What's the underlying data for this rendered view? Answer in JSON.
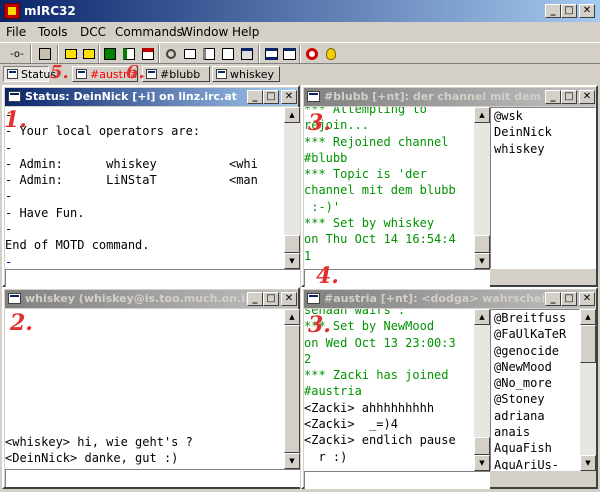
{
  "app": {
    "title": "mIRC32",
    "controls": {
      "minimize": "_",
      "maximize": "□",
      "close": "✕"
    }
  },
  "menu": [
    "File",
    "Tools",
    "DCC",
    "Commands",
    "Window",
    "Help"
  ],
  "toolbar": [
    "connect-icon",
    "options-icon",
    "channel-list-icon",
    "channels-folder-icon",
    "address-book-icon",
    "notify-list-icon",
    "script-editor-icon",
    "dcc-send-icon",
    "dcc-chat-icon",
    "finger-icon",
    "received-files-icon",
    "logs-icon",
    "tile-horizontal-icon",
    "tile-vertical-icon",
    "help-icon",
    "about-icon"
  ],
  "switchbar": [
    {
      "label": "Status",
      "color": "#000000"
    },
    {
      "label": "#austria",
      "color": "#ff0000"
    },
    {
      "label": "#blubb",
      "color": "#000000"
    },
    {
      "label": "whiskey",
      "color": "#000000"
    }
  ],
  "annotations": [
    "1.",
    "2.",
    "3.",
    "3.",
    "4.",
    "5.",
    "6."
  ],
  "colors": {
    "green_text": "#009300",
    "annotation_red": "#e03030",
    "active_title": "#0a246a",
    "inactive_title": "#808080"
  },
  "windows": {
    "status": {
      "title": "Status: DeinNick [+i] on linz.irc.at",
      "lines": [
        "-",
        "- Your local operators are:",
        "-",
        "- Admin:      whiskey          <whi",
        "- Admin:      LiNStaT          <man",
        "-",
        "- Have Fun.",
        "-",
        "End of MOTD command.",
        "-"
      ]
    },
    "blubb": {
      "title": "#blubb [+nt]: der channel mit dem blubb",
      "lines": [
        "*** Attempting to",
        "rejoin...",
        "*** Rejoined channel",
        "#blubb",
        "*** Topic is 'der",
        "channel mit dem blubb",
        " :-)'",
        "*** Set by whiskey",
        "on Thu Oct 14 16:54:4",
        "1"
      ],
      "nicks": [
        "@wsk",
        "DeinNick",
        "whiskey"
      ]
    },
    "query": {
      "title": "whiskey (whiskey@is.too.much.on.irc.at)",
      "lines": [
        "<whiskey> hi, wie geht's ?",
        "<DeinNick> danke, gut :)"
      ]
    },
    "austria": {
      "title": "#austria [+nt]: <dodga> wahrscheinlich",
      "lines": [
        "sehaan wairs :",
        "*** Set by NewMood",
        "on Wed Oct 13 23:00:3",
        "2",
        "*** Zacki has joined",
        "#austria",
        "<Zacki> ahhhhhhhhh",
        "<Zacki>  _=)4",
        "<Zacki> endlich pause",
        "  r :)"
      ],
      "nicks": [
        "@Breitfuss",
        "@FaUlKaTeR",
        "@genocide",
        "@NewMood",
        "@No_more",
        "@Stoney",
        "adriana",
        "anais",
        "AquaFish",
        "AquAriUs-"
      ]
    }
  }
}
